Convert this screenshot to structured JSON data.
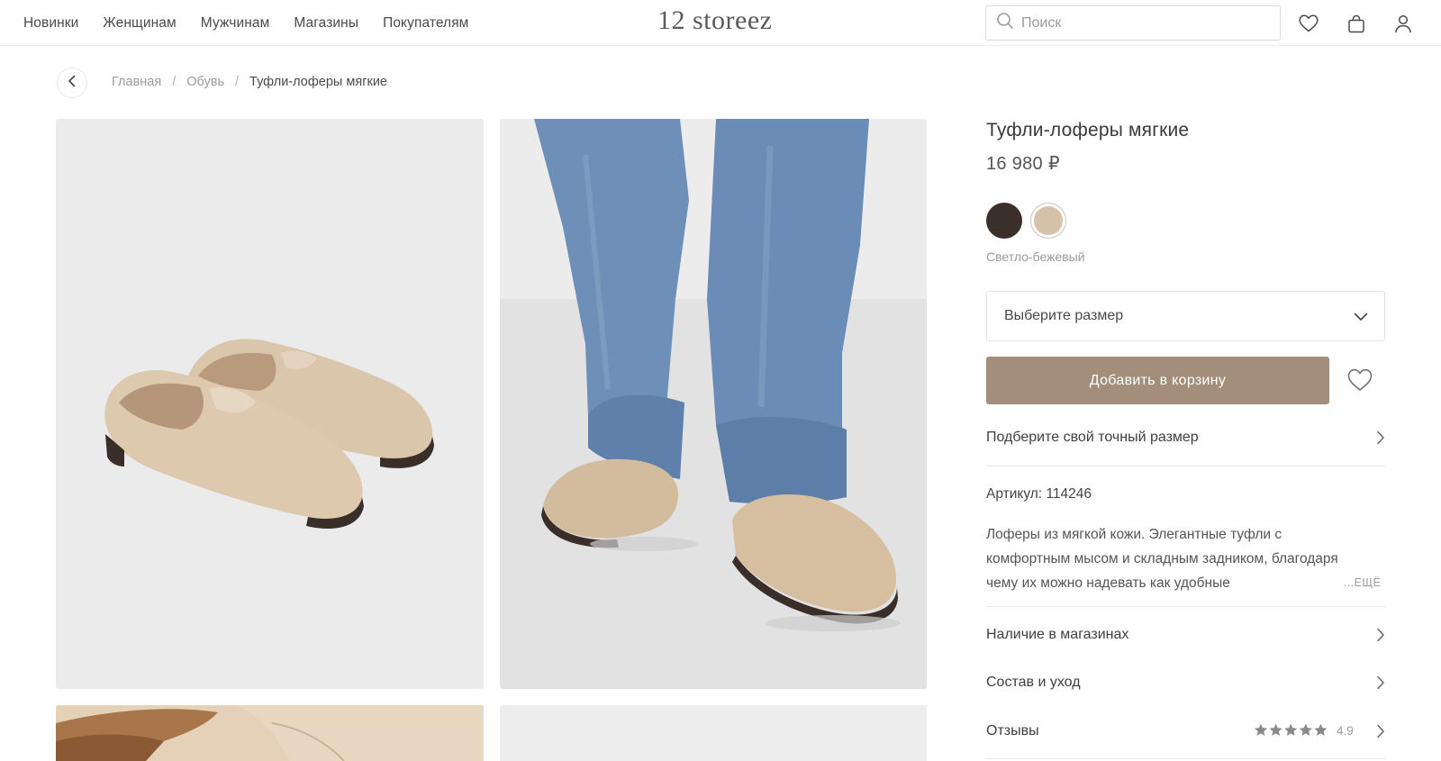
{
  "header": {
    "nav": [
      "Новинки",
      "Женщинам",
      "Мужчинам",
      "Магазины",
      "Покупателям"
    ],
    "logo": "12 storeez",
    "search_placeholder": "Поиск",
    "icons": [
      "heart-icon",
      "bag-icon",
      "user-icon"
    ]
  },
  "breadcrumb": {
    "items": [
      "Главная",
      "Обувь"
    ],
    "current": "Туфли-лоферы мягкие",
    "separator": "/"
  },
  "gallery": {
    "photos": [
      "loafers-pair-on-grey",
      "loafers-worn-with-jeans",
      "loafer-closeup",
      "blank-light-grey"
    ]
  },
  "product": {
    "title": "Туфли-лоферы мягкие",
    "price": "16 980 ₽",
    "colors": [
      {
        "name": "Тёмно-коричневый",
        "hex": "#3b2f2a",
        "selected": false
      },
      {
        "name": "Светло-бежевый",
        "hex": "#d6c2ab",
        "selected": true
      }
    ],
    "selected_color_label": "Светло-бежевый",
    "size_placeholder": "Выберите размер",
    "add_to_cart": "Добавить в корзину",
    "fit_link": "Подберите свой точный размер",
    "sku": "Артикул: 114246",
    "description": "Лоферы из мягкой кожи. Элегантные туфли с комфортным мысом и складным задником, благодаря чему их можно надевать как удобные",
    "more_label": "...ЕЩЁ",
    "availability": "Наличие в магазинах",
    "composition": "Состав и уход",
    "reviews": "Отзывы",
    "rating": "4.9",
    "rating_stars": 5
  },
  "colors": {
    "accent": "#a28e7a",
    "text": "#3d3d3d",
    "muted": "#9a9a9a"
  }
}
